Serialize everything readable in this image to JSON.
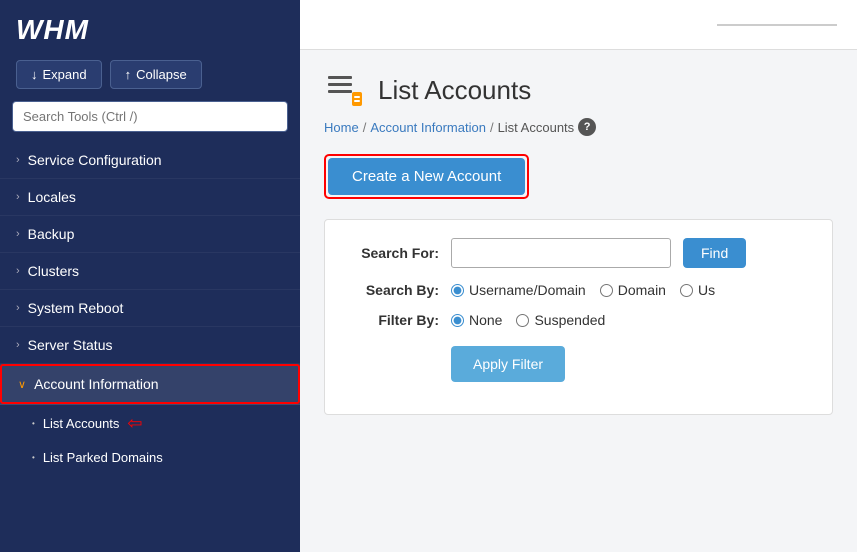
{
  "app": {
    "logo": "WHM"
  },
  "sidebar": {
    "expand_label": "Expand",
    "collapse_label": "Collapse",
    "search_placeholder": "Search Tools (Ctrl /)",
    "search_highlight": "Search",
    "nav_items": [
      {
        "id": "service-config",
        "label": "Service Configuration",
        "active": false
      },
      {
        "id": "locales",
        "label": "Locales",
        "active": false
      },
      {
        "id": "backup",
        "label": "Backup",
        "active": false
      },
      {
        "id": "clusters",
        "label": "Clusters",
        "active": false
      },
      {
        "id": "system-reboot",
        "label": "System Reboot",
        "active": false
      },
      {
        "id": "server-status",
        "label": "Server Status",
        "active": false
      },
      {
        "id": "account-info",
        "label": "Account Information",
        "active": true
      }
    ],
    "sub_items": [
      {
        "id": "list-accounts",
        "label": "List Accounts",
        "active": true
      },
      {
        "id": "list-parked",
        "label": "List Parked Domains",
        "active": false
      }
    ]
  },
  "main": {
    "page_title": "List Accounts",
    "breadcrumb": {
      "home": "Home",
      "account_info": "Account Information",
      "current": "List Accounts"
    },
    "create_btn_label": "Create a New Account",
    "search_section": {
      "search_for_label": "Search For:",
      "search_by_label": "Search By:",
      "filter_by_label": "Filter By:",
      "find_btn_label": "Find",
      "apply_filter_label": "Apply Filter",
      "search_by_options": [
        {
          "id": "username-domain",
          "label": "Username/Domain",
          "checked": true
        },
        {
          "id": "domain",
          "label": "Domain",
          "checked": false
        },
        {
          "id": "us",
          "label": "Us",
          "checked": false
        }
      ],
      "filter_by_options": [
        {
          "id": "none",
          "label": "None",
          "checked": true
        },
        {
          "id": "suspended",
          "label": "Suspended",
          "checked": false
        }
      ]
    }
  }
}
